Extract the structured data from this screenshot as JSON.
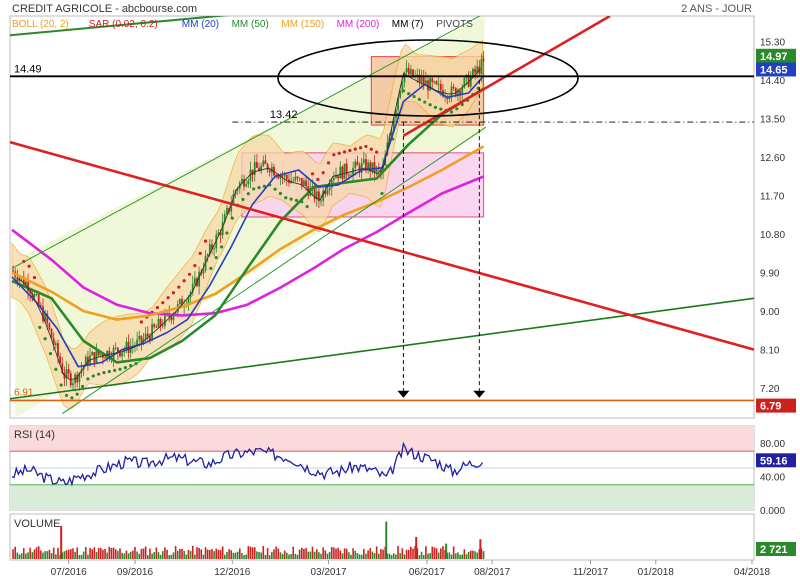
{
  "header": {
    "title": "CREDIT AGRICOLE - abcbourse.com",
    "period": "2 ANS - JOUR",
    "legend": [
      {
        "label": "BOLL (20, 2)",
        "color": "#f0a020"
      },
      {
        "label": "SAR (0.02, 0.2)",
        "color": "#cc2020"
      },
      {
        "label": "MM (20)",
        "color": "#2040c0"
      },
      {
        "label": "MM (50)",
        "color": "#2a8a2a"
      },
      {
        "label": "MM (150)",
        "color": "#f0a020"
      },
      {
        "label": "MM (200)",
        "color": "#e020e0"
      },
      {
        "label": "MM (7)",
        "color": "#000000"
      },
      {
        "label": "PIVOTS",
        "color": "#444444"
      }
    ]
  },
  "chart_data": [
    {
      "type": "line",
      "panel": "price",
      "ylim": [
        6.5,
        15.9
      ],
      "y_ticks": [
        "15.30",
        "14.40",
        "13.50",
        "12.60",
        "11.70",
        "10.80",
        "9.90",
        "9.00",
        "8.10",
        "7.20"
      ],
      "y_tick_values": [
        15.3,
        14.4,
        13.5,
        12.6,
        11.7,
        10.8,
        9.9,
        9.0,
        8.1,
        7.2
      ],
      "x_ticks": [
        "07/2016",
        "09/2016",
        "12/2016",
        "03/2017",
        "06/2017",
        "08/2017",
        "11/2017",
        "01/2018",
        "04/2018"
      ],
      "x_tick_dates": [
        "2016-07-01",
        "2016-09-01",
        "2016-12-01",
        "2017-03-01",
        "2017-06-01",
        "2017-08-01",
        "2017-11-01",
        "2018-01-01",
        "2018-04-01"
      ],
      "series": [
        {
          "name": "close",
          "color": "#3a7a2a",
          "x": [
            "2016-05-09",
            "2016-05-25",
            "2016-06-10",
            "2016-06-27",
            "2016-07-06",
            "2016-07-20",
            "2016-08-01",
            "2016-08-20",
            "2016-09-05",
            "2016-09-25",
            "2016-10-10",
            "2016-10-25",
            "2016-11-08",
            "2016-11-22",
            "2016-12-05",
            "2016-12-20",
            "2017-01-05",
            "2017-01-20",
            "2017-02-05",
            "2017-02-20",
            "2017-03-05",
            "2017-03-20",
            "2017-04-05",
            "2017-04-20",
            "2017-05-01",
            "2017-05-10",
            "2017-05-25",
            "2017-06-10",
            "2017-06-25",
            "2017-07-10",
            "2017-07-24"
          ],
          "y": [
            9.95,
            9.6,
            8.75,
            7.5,
            7.4,
            7.9,
            8.0,
            8.1,
            8.25,
            8.7,
            9.05,
            9.5,
            10.3,
            11.0,
            11.9,
            12.3,
            12.4,
            12.1,
            12.0,
            11.6,
            12.2,
            12.3,
            12.4,
            12.2,
            13.6,
            14.6,
            14.4,
            14.2,
            14.1,
            14.4,
            14.8
          ]
        },
        {
          "name": "MM (200)",
          "color": "#e020e0",
          "x": [
            "2016-05-09",
            "2016-06-15",
            "2016-07-15",
            "2016-08-15",
            "2016-09-15",
            "2016-10-15",
            "2016-11-15",
            "2016-12-15",
            "2017-01-15",
            "2017-02-15",
            "2017-03-15",
            "2017-04-15",
            "2017-05-15",
            "2017-06-15",
            "2017-07-24"
          ],
          "y": [
            10.9,
            10.2,
            9.55,
            9.15,
            8.95,
            8.9,
            8.95,
            9.15,
            9.55,
            10.0,
            10.45,
            10.85,
            11.3,
            11.75,
            12.15
          ]
        },
        {
          "name": "MM (150)",
          "color": "#f0a020",
          "x": [
            "2016-05-09",
            "2016-06-15",
            "2016-07-15",
            "2016-08-15",
            "2016-09-15",
            "2016-10-15",
            "2016-11-15",
            "2016-12-15",
            "2017-01-15",
            "2017-02-15",
            "2017-03-15",
            "2017-04-15",
            "2017-05-15",
            "2017-06-15",
            "2017-07-24"
          ],
          "y": [
            9.9,
            9.45,
            9.0,
            8.8,
            8.9,
            9.1,
            9.4,
            9.9,
            10.45,
            10.9,
            11.25,
            11.55,
            11.9,
            12.3,
            12.85
          ]
        },
        {
          "name": "MM (50)",
          "color": "#2a8a2a",
          "x": [
            "2016-05-09",
            "2016-06-15",
            "2016-07-15",
            "2016-08-15",
            "2016-09-15",
            "2016-10-15",
            "2016-11-15",
            "2016-12-15",
            "2017-01-15",
            "2017-02-15",
            "2017-03-15",
            "2017-04-15",
            "2017-05-15",
            "2017-06-15",
            "2017-07-24"
          ],
          "y": [
            9.7,
            9.3,
            8.3,
            7.8,
            7.9,
            8.3,
            8.9,
            10.0,
            11.1,
            11.9,
            12.0,
            12.1,
            12.9,
            13.6,
            14.2
          ]
        },
        {
          "name": "MM (20)",
          "color": "#2040c0",
          "x": [
            "2016-05-09",
            "2016-06-01",
            "2016-06-20",
            "2016-07-10",
            "2016-08-01",
            "2016-08-20",
            "2016-09-10",
            "2016-10-01",
            "2016-10-20",
            "2016-11-10",
            "2016-11-30",
            "2016-12-20",
            "2017-01-10",
            "2017-02-01",
            "2017-02-20",
            "2017-03-10",
            "2017-04-01",
            "2017-04-20",
            "2017-05-10",
            "2017-05-30",
            "2017-06-20",
            "2017-07-10",
            "2017-07-24"
          ],
          "y": [
            9.8,
            9.2,
            8.6,
            7.7,
            7.8,
            8.1,
            8.25,
            8.5,
            8.8,
            9.6,
            10.5,
            11.5,
            12.15,
            12.3,
            11.9,
            11.95,
            12.3,
            12.35,
            13.9,
            14.3,
            14.0,
            14.1,
            14.5
          ]
        }
      ],
      "annotations": {
        "resistance_line": {
          "label": "14.49",
          "value": 14.49
        },
        "support_line": {
          "label": "13.42",
          "value": 13.42
        },
        "low_line": {
          "label": "6.91",
          "value": 6.91
        },
        "last_prices": [
          {
            "label": "14.97",
            "value": 14.97,
            "color": "#2a8a2a"
          },
          {
            "label": "14.65",
            "value": 14.65,
            "color": "#2040c0"
          },
          {
            "label": "6.79",
            "value": 6.79,
            "color": "#cc2020"
          }
        ]
      }
    },
    {
      "type": "line",
      "panel": "RSI (14)",
      "ylim": [
        0,
        100
      ],
      "y_ticks": [
        "80.00",
        "40.00",
        "0.000"
      ],
      "y_tick_values": [
        80,
        40,
        0
      ],
      "series": [
        {
          "name": "RSI (14)",
          "color": "#2020a0",
          "x": [
            "2016-05-09",
            "2016-05-25",
            "2016-06-10",
            "2016-06-27",
            "2016-07-10",
            "2016-07-25",
            "2016-08-10",
            "2016-08-25",
            "2016-09-10",
            "2016-09-25",
            "2016-10-10",
            "2016-10-25",
            "2016-11-10",
            "2016-11-25",
            "2016-12-10",
            "2016-12-25",
            "2017-01-10",
            "2017-01-25",
            "2017-02-10",
            "2017-02-25",
            "2017-03-10",
            "2017-03-25",
            "2017-04-10",
            "2017-04-25",
            "2017-05-10",
            "2017-05-25",
            "2017-06-10",
            "2017-06-25",
            "2017-07-10",
            "2017-07-24"
          ],
          "y": [
            42,
            48,
            38,
            32,
            40,
            45,
            52,
            58,
            55,
            60,
            62,
            58,
            55,
            64,
            68,
            70,
            66,
            62,
            50,
            44,
            46,
            52,
            48,
            38,
            72,
            65,
            58,
            46,
            55,
            59.16
          ]
        }
      ],
      "last_value": {
        "label": "59.16",
        "value": 59.16
      }
    },
    {
      "type": "bar",
      "panel": "VOLUME",
      "last_value": {
        "label": "2 721",
        "value": 2721
      },
      "x": [
        "2016-06-24",
        "2017-04-24",
        "2017-05-22",
        "2017-06-19",
        "2017-07-21"
      ],
      "y_relative": [
        0.75,
        0.85,
        0.5,
        0.35,
        0.45
      ]
    }
  ]
}
